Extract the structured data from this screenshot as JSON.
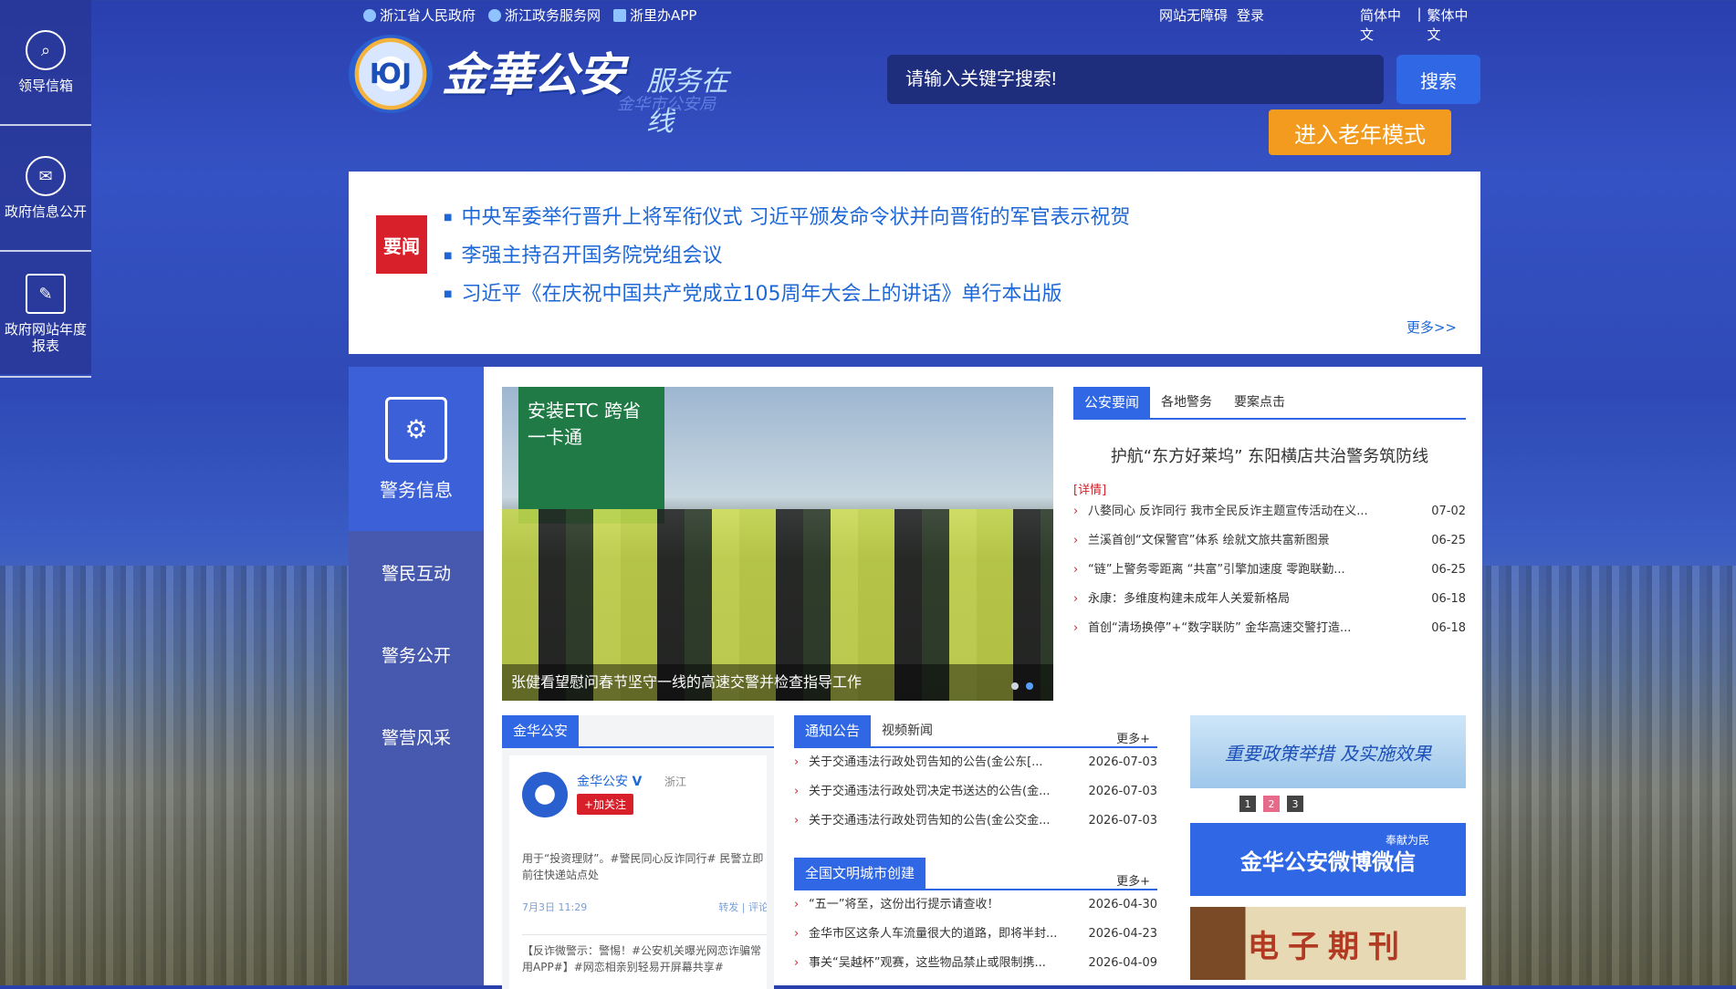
{
  "sidebar": {
    "items": [
      {
        "label": "领导信箱",
        "icon": "search-icon"
      },
      {
        "label": "政府信息公开",
        "icon": "mail-icon"
      },
      {
        "label": "政府网站年度报表",
        "icon": "report-icon"
      }
    ]
  },
  "topbar": {
    "links": [
      "浙江省人民政府",
      "浙江政务服务网",
      "浙里办APP"
    ],
    "accessibility": "网站无障碍",
    "login": "登录",
    "lang_simplified": "简体中文",
    "lang_sep": "|",
    "lang_traditional": "繁体中文"
  },
  "logo": {
    "badge": "ЮJ",
    "title": "金華公安",
    "subtitle": "服务在线",
    "org": "金华市公安局"
  },
  "search": {
    "placeholder": "请输入关键字搜索!",
    "button": "搜索"
  },
  "elder_mode": "进入老年模式",
  "headlines": {
    "tag": "要闻",
    "items": [
      "中央军委举行晋升上将军衔仪式 习近平颁发命令状并向晋衔的军官表示祝贺",
      "李强主持召开国务院党组会议",
      "习近平《在庆祝中国共产党成立105周年大会上的讲话》单行本出版"
    ],
    "more": "更多>>"
  },
  "leftnav": {
    "active": "警务信息",
    "items": [
      "警民互动",
      "警务公开",
      "警营风采"
    ]
  },
  "photo": {
    "sign": "安装ETC 跨省一卡通",
    "caption": "张健看望慰问春节坚守一线的高速交警并检查指导工作"
  },
  "news": {
    "tabs": [
      "公安要闻",
      "各地警务",
      "要案点击"
    ],
    "featured": "护航“东方好莱坞” 东阳横店共治警务筑防线",
    "detail": "[详情]",
    "items": [
      {
        "text": "八婺同心 反诈同行 我市全民反诈主题宣传活动在义...",
        "date": "07-02"
      },
      {
        "text": "兰溪首创“文保警官”体系 绘就文旅共富新图景",
        "date": "06-25"
      },
      {
        "text": "“链”上警务零距离 “共富”引擎加速度 零跑联勤...",
        "date": "06-25"
      },
      {
        "text": "永康：多维度构建未成年人关爱新格局",
        "date": "06-18"
      },
      {
        "text": "首创“清场换停”+“数字联防” 金华高速交警打造...",
        "date": "06-18"
      }
    ]
  },
  "weibo": {
    "tab": "金华公安",
    "user": "金华公安",
    "verified": "V",
    "location": "浙江",
    "follow": "+加关注",
    "post1": "用于“投资理财”。#警民同心反诈同行# 民警立即前往快递站点处",
    "time": "7月3日 11:29",
    "actions": "转发 | 评论",
    "post2": "【反诈微警示：警惕！#公安机关曝光网恋诈骗常用APP#】#网恋相亲别轻易开屏幕共享#"
  },
  "notice": {
    "tabs": [
      "通知公告",
      "视频新闻"
    ],
    "more": "更多+",
    "items": [
      {
        "text": "关于交通违法行政处罚告知的公告(金公东[...",
        "date": "2026-07-03"
      },
      {
        "text": "关于交通违法行政处罚决定书送达的公告(金...",
        "date": "2026-07-03"
      },
      {
        "text": "关于交通违法行政处罚告知的公告(金公交金...",
        "date": "2026-07-03"
      }
    ]
  },
  "civic": {
    "tab": "全国文明城市创建",
    "more": "更多+",
    "items": [
      {
        "text": "“五一”将至，这份出行提示请查收！",
        "date": "2026-04-30"
      },
      {
        "text": "金华市区这条人车流量很大的道路，即将半封...",
        "date": "2026-04-23"
      },
      {
        "text": "事关“吴越杯”观赛，这些物品禁止或限制携...",
        "date": "2026-04-09"
      }
    ]
  },
  "banners": {
    "policy": "重要政策举措 及实施效果",
    "pages": [
      "1",
      "2",
      "3"
    ],
    "weibo_wechat": "金华公安微博微信",
    "weibo_small": "奉献为民",
    "ejournal": "电子期刊"
  },
  "colors": {
    "primary": "#2f67e4",
    "accent": "#f29b1e",
    "alert": "#d8202a"
  }
}
